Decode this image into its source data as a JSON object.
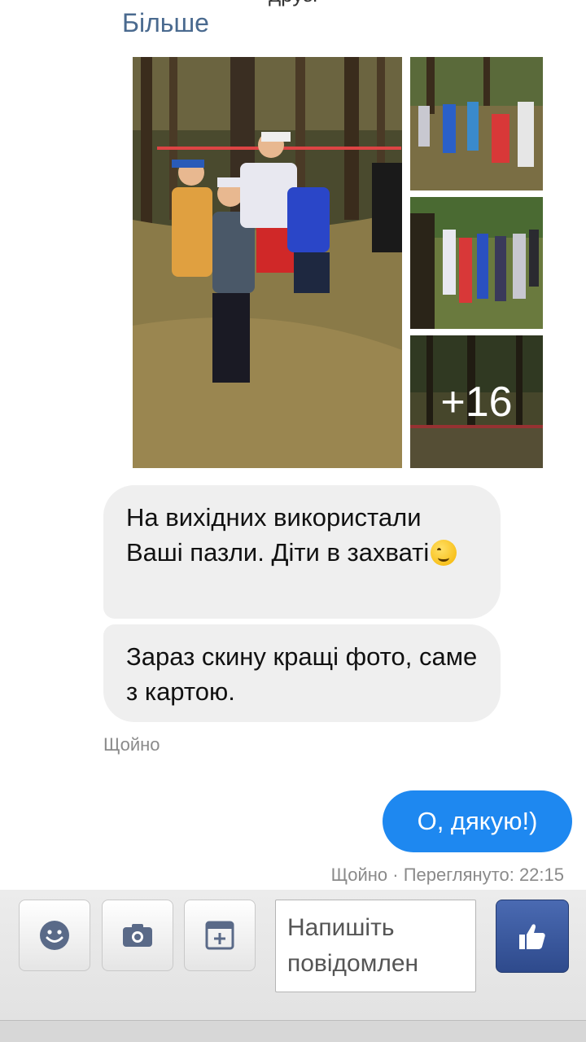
{
  "conversation": {
    "cut_text": "друзі",
    "more_link": "Більше",
    "photos": {
      "more_count": "+16"
    },
    "incoming": [
      {
        "text": "На вихідних використали Ваші пазли. Діти в захваті",
        "emoji": "wink-face-emoji"
      },
      {
        "text": "Зараз скину кращі фото, саме з картою."
      }
    ],
    "incoming_timestamp": "Щойно",
    "outgoing": [
      {
        "text": "О, дякую!)"
      }
    ],
    "outgoing_status": "Щойно · Переглянуто: 22:15"
  },
  "composer": {
    "placeholder": "Напишіть повідомлен",
    "buttons": {
      "emoji": "smiley-icon",
      "camera": "camera-icon",
      "sticker": "sticker-icon",
      "like": "thumbs-up-icon"
    }
  },
  "colors": {
    "outgoing_bubble": "#1e88f0",
    "incoming_bubble": "#efefef",
    "like_button": "#3b5998",
    "link": "#4a6a8f"
  }
}
